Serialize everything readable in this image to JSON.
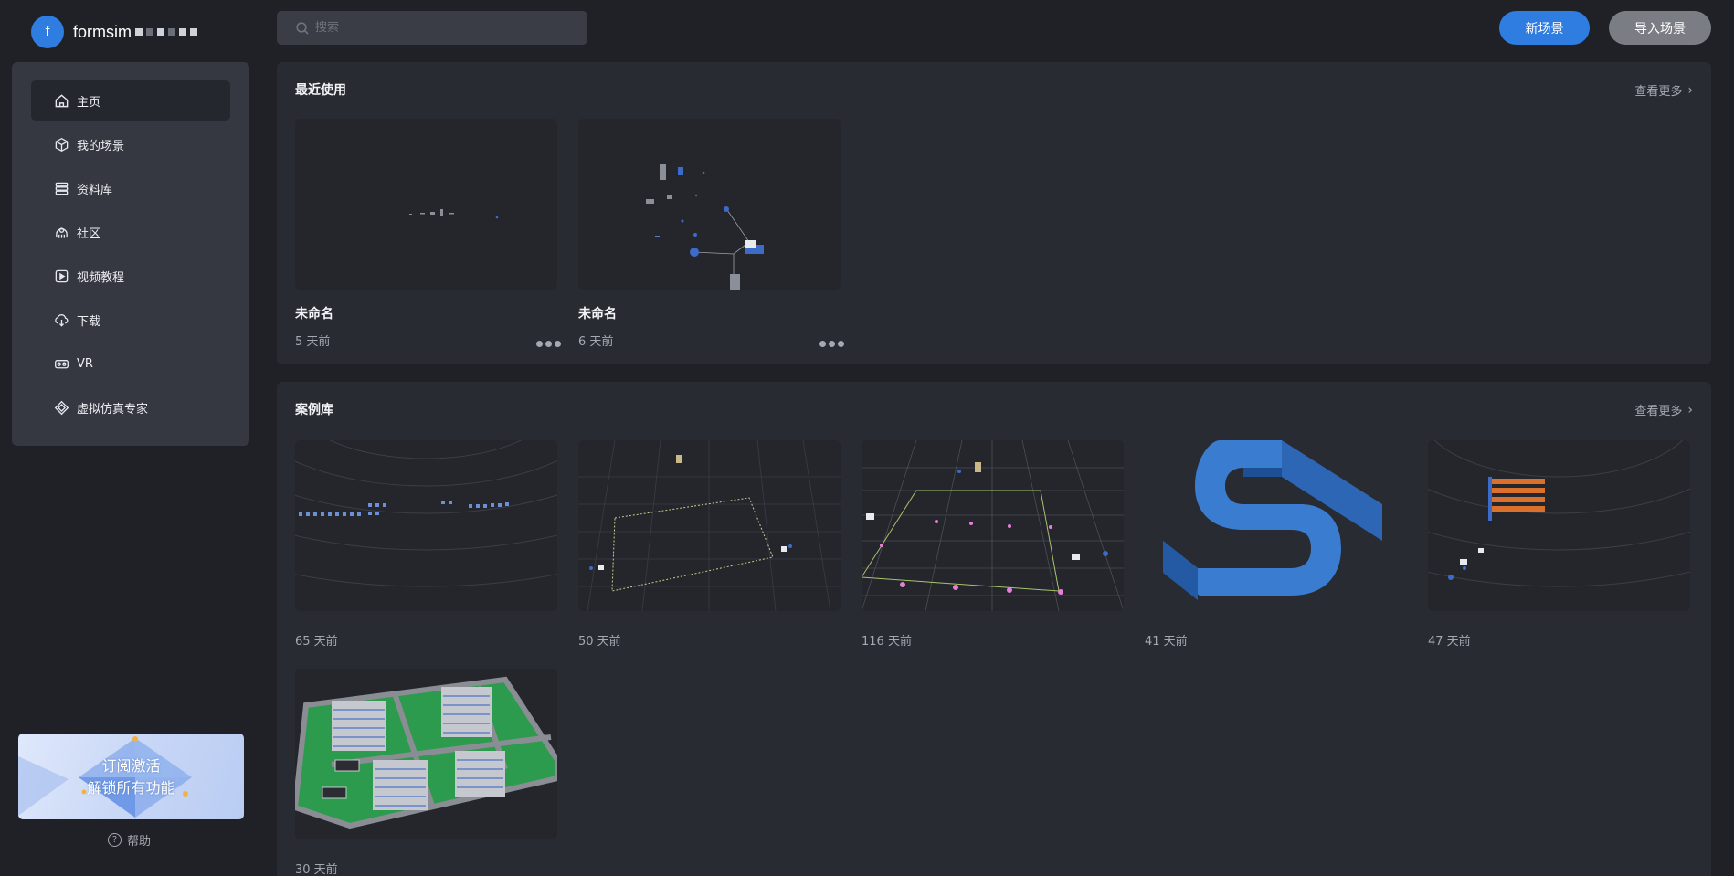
{
  "brand": {
    "avatar_letter": "f",
    "name": "formsim"
  },
  "search": {
    "placeholder": "搜索"
  },
  "header": {
    "new_scene": "新场景",
    "import_scene": "导入场景"
  },
  "sidebar": {
    "items": [
      {
        "label": "主页",
        "icon": "home-icon",
        "active": true
      },
      {
        "label": "我的场景",
        "icon": "cube-icon"
      },
      {
        "label": "资料库",
        "icon": "database-icon"
      },
      {
        "label": "社区",
        "icon": "community-icon"
      },
      {
        "label": "视频教程",
        "icon": "play-icon"
      },
      {
        "label": "下载",
        "icon": "cloud-download-icon"
      },
      {
        "label": "VR",
        "icon": "vr-headset-icon"
      },
      {
        "label": "虚拟仿真专家",
        "icon": "diamond-icon"
      }
    ]
  },
  "promo": {
    "line1": "订阅激活",
    "line2": "解锁所有功能"
  },
  "help": {
    "label": "帮助"
  },
  "recent": {
    "title": "最近使用",
    "more": "查看更多",
    "cards": [
      {
        "name": "未命名",
        "time": "5 天前"
      },
      {
        "name": "未命名",
        "time": "6 天前"
      }
    ]
  },
  "cases": {
    "title": "案例库",
    "more": "查看更多",
    "cards": [
      {
        "time": "65 天前"
      },
      {
        "time": "50 天前"
      },
      {
        "time": "116 天前"
      },
      {
        "time": "41 天前"
      },
      {
        "time": "47 天前"
      },
      {
        "time": "30 天前"
      }
    ]
  },
  "colors": {
    "accent": "#2f7de1",
    "background": "#1f2127",
    "panel": "#292b32",
    "sidebar": "#353840"
  }
}
